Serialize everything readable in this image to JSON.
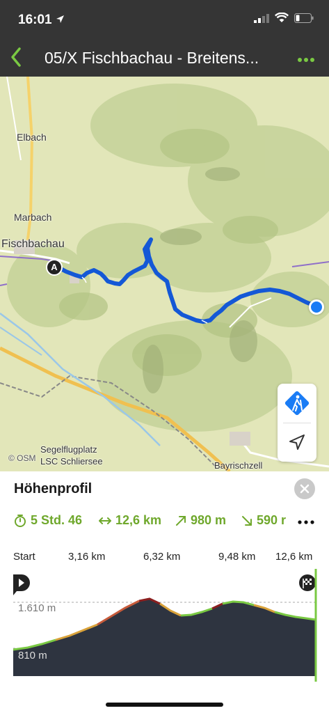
{
  "status_bar": {
    "time": "16:01"
  },
  "nav": {
    "title": "05/X Fischbachau - Breitens..."
  },
  "map": {
    "places": [
      "Elbach",
      "Marbach",
      "Fischbachau",
      "Segelflugplatz",
      "LSC Schliersee",
      "Bayrischzell"
    ],
    "attribution": "© OSM",
    "start_marker": "A"
  },
  "panel": {
    "title": "Höhenprofil",
    "stats": {
      "duration": "5 Std. 46",
      "distance": "12,6 km",
      "ascent": "980 m",
      "descent": "590 r"
    },
    "axis": {
      "start": "Start",
      "d1": "3,16 km",
      "d2": "6,32 km",
      "d3": "9,48 km",
      "d4": "12,6 km"
    },
    "elevation": {
      "max": "1.610 m",
      "min": "810 m"
    }
  },
  "colors": {
    "accent": "#6fa82c",
    "route": "#1458d6",
    "profile_fill": "#2e3440"
  }
}
